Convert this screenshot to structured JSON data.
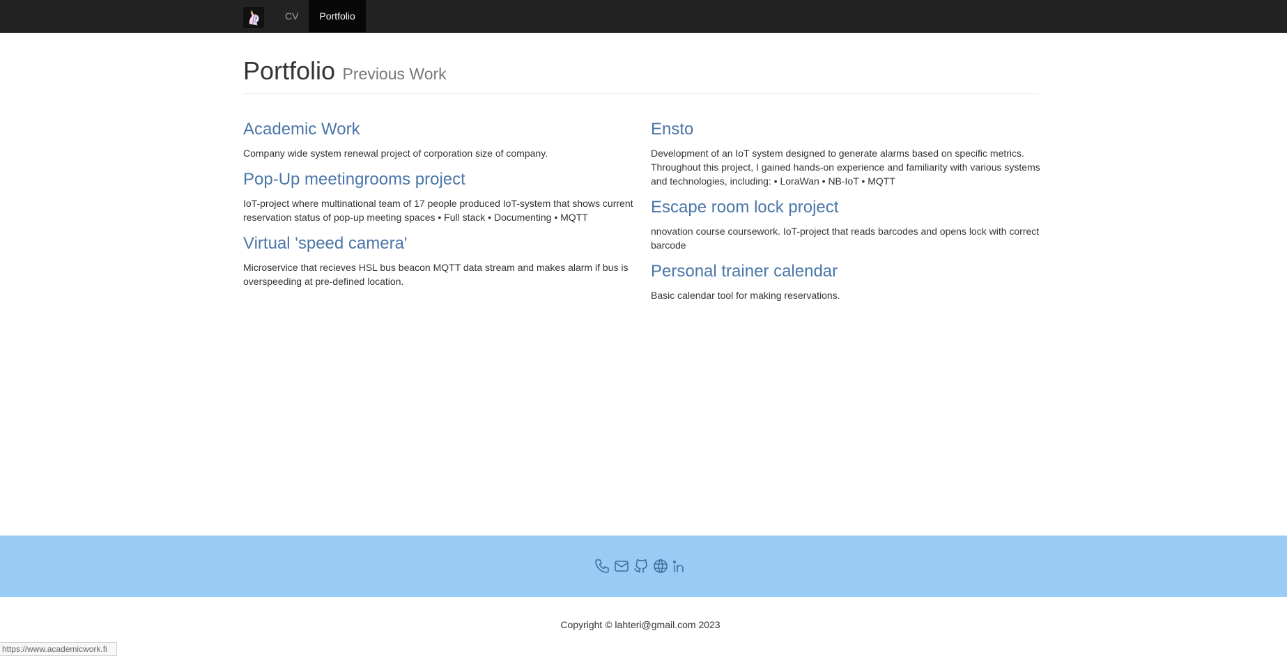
{
  "nav": {
    "brand_icon": "unicorn-logo-icon",
    "items": [
      {
        "label": "CV",
        "active": false
      },
      {
        "label": "Portfolio",
        "active": true
      }
    ]
  },
  "header": {
    "title": "Portfolio",
    "subtitle": "Previous Work"
  },
  "left_column": [
    {
      "title": "Academic Work",
      "description": "Company wide system renewal project of corporation size of company."
    },
    {
      "title": "Pop-Up meetingrooms project",
      "description": "IoT-project where multinational team of 17 people produced IoT-system that shows current reservation status of pop-up meeting spaces • Full stack • Documenting • MQTT"
    },
    {
      "title": "Virtual 'speed camera'",
      "description": "Microservice that recieves HSL bus beacon MQTT data stream and makes alarm if bus is overspeeding at pre-defined location."
    }
  ],
  "right_column": [
    {
      "title": "Ensto",
      "description": "Development of an IoT system designed to generate alarms based on specific metrics. Throughout this project, I gained hands-on experience and familiarity with various systems and technologies, including: • LoraWan • NB-IoT • MQTT"
    },
    {
      "title": "Escape room lock project",
      "description": "nnovation course coursework. IoT-project that reads barcodes and opens lock with correct barcode"
    },
    {
      "title": "Personal trainer calendar",
      "description": "Basic calendar tool for making reservations."
    }
  ],
  "footer": {
    "icons": [
      "phone-icon",
      "mail-icon",
      "github-icon",
      "globe-icon",
      "linkedin-icon"
    ],
    "band_color": "#99ccf5",
    "copyright": "Copyright © lahteri@gmail.com 2023"
  },
  "status_bar": {
    "url": "https://www.academicwork.fi"
  }
}
